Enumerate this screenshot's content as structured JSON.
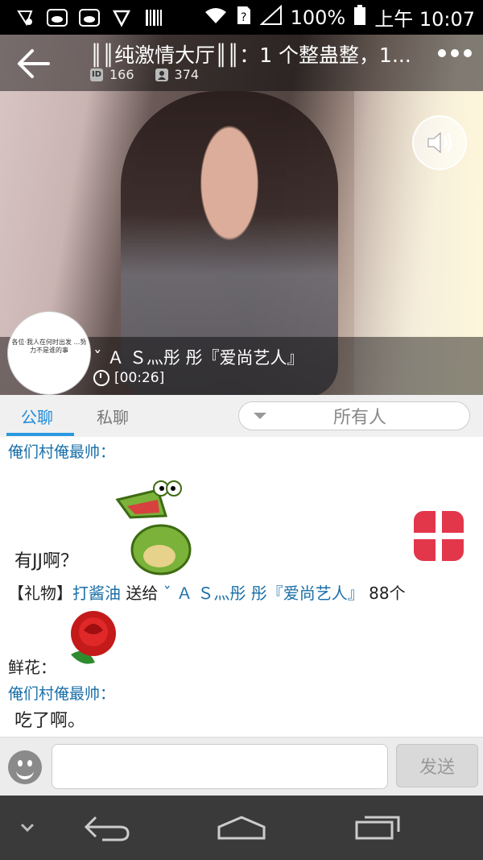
{
  "status_bar": {
    "battery": "100%",
    "time": "上午 10:07",
    "icons": [
      "notification-icon",
      "weather-cloud-icon",
      "weather-cloud-icon",
      "shield-icon",
      "barcode-icon",
      "wifi-icon",
      "sim-unknown-icon",
      "signal-icon",
      "battery-icon"
    ]
  },
  "header": {
    "room_title": "║║纯激情大厅║║：1 个整蛊整，1...",
    "room_id": "166",
    "online_count": "374"
  },
  "anchor": {
    "name": "ˇ Ａ Ｓ灬彤 彤『爱尚艺人』",
    "duration": "[00:26]",
    "avatar_caption": "各位·我人在何时出发 …努力不是谁的事"
  },
  "tabs": {
    "public": "公聊",
    "private": "私聊",
    "target": "所有人"
  },
  "chat": {
    "messages": [
      {
        "sender": "俺们村俺最帅：",
        "text": "有JJ啊？"
      },
      {
        "gift_prefix": "【礼物】",
        "gift_giver": "打酱油",
        "gift_verb": " 送给",
        "gift_receiver": "ˇ Ａ Ｓ灬彤 彤『爱尚艺人』",
        "gift_count": " 88个"
      },
      {
        "flower_label": "鲜花："
      },
      {
        "sender": "俺们村俺最帅：",
        "text": "吃了啊。"
      }
    ]
  },
  "input": {
    "placeholder": "",
    "send_label": "发送"
  },
  "colors": {
    "accent": "#1f8bd8",
    "sender": "#1a6fa8",
    "gift_red": "#e2364a"
  }
}
